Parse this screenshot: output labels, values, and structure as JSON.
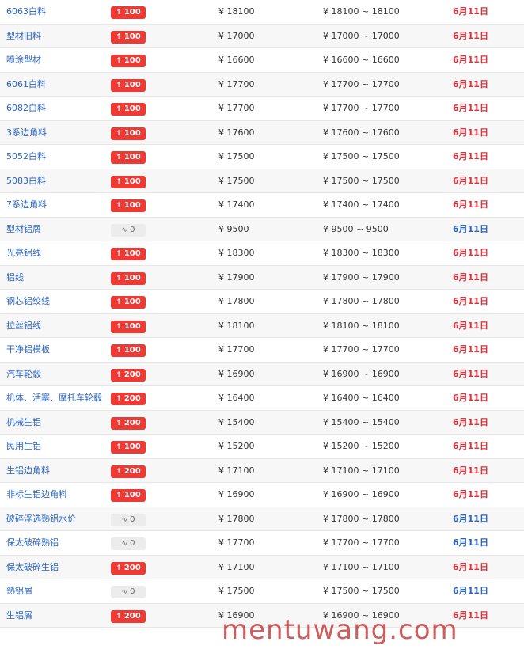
{
  "currency_symbol": "¥",
  "range_separator": "~",
  "rows": [
    {
      "name": "6063白料",
      "change": "100",
      "trend": "up",
      "price": "18100",
      "range_low": "18100",
      "range_high": "18100",
      "date": "6月11日"
    },
    {
      "name": "型材旧料",
      "change": "100",
      "trend": "up",
      "price": "17000",
      "range_low": "17000",
      "range_high": "17000",
      "date": "6月11日"
    },
    {
      "name": "喷涂型材",
      "change": "100",
      "trend": "up",
      "price": "16600",
      "range_low": "16600",
      "range_high": "16600",
      "date": "6月11日"
    },
    {
      "name": "6061白料",
      "change": "100",
      "trend": "up",
      "price": "17700",
      "range_low": "17700",
      "range_high": "17700",
      "date": "6月11日"
    },
    {
      "name": "6082白料",
      "change": "100",
      "trend": "up",
      "price": "17700",
      "range_low": "17700",
      "range_high": "17700",
      "date": "6月11日"
    },
    {
      "name": "3系边角料",
      "change": "100",
      "trend": "up",
      "price": "17600",
      "range_low": "17600",
      "range_high": "17600",
      "date": "6月11日"
    },
    {
      "name": "5052白料",
      "change": "100",
      "trend": "up",
      "price": "17500",
      "range_low": "17500",
      "range_high": "17500",
      "date": "6月11日"
    },
    {
      "name": "5083白料",
      "change": "100",
      "trend": "up",
      "price": "17500",
      "range_low": "17500",
      "range_high": "17500",
      "date": "6月11日"
    },
    {
      "name": "7系边角料",
      "change": "100",
      "trend": "up",
      "price": "17400",
      "range_low": "17400",
      "range_high": "17400",
      "date": "6月11日"
    },
    {
      "name": "型材铝屑",
      "change": "0",
      "trend": "flat",
      "price": "9500",
      "range_low": "9500",
      "range_high": "9500",
      "date": "6月11日"
    },
    {
      "name": "光亮铝线",
      "change": "100",
      "trend": "up",
      "price": "18300",
      "range_low": "18300",
      "range_high": "18300",
      "date": "6月11日"
    },
    {
      "name": "铝线",
      "change": "100",
      "trend": "up",
      "price": "17900",
      "range_low": "17900",
      "range_high": "17900",
      "date": "6月11日"
    },
    {
      "name": "钢芯铝绞线",
      "change": "100",
      "trend": "up",
      "price": "17800",
      "range_low": "17800",
      "range_high": "17800",
      "date": "6月11日"
    },
    {
      "name": "拉丝铝线",
      "change": "100",
      "trend": "up",
      "price": "18100",
      "range_low": "18100",
      "range_high": "18100",
      "date": "6月11日"
    },
    {
      "name": "干净铝模板",
      "change": "100",
      "trend": "up",
      "price": "17700",
      "range_low": "17700",
      "range_high": "17700",
      "date": "6月11日"
    },
    {
      "name": "汽车轮毂",
      "change": "200",
      "trend": "up",
      "price": "16900",
      "range_low": "16900",
      "range_high": "16900",
      "date": "6月11日"
    },
    {
      "name": "机体、活塞、摩托车轮毂",
      "change": "200",
      "trend": "up",
      "price": "16400",
      "range_low": "16400",
      "range_high": "16400",
      "date": "6月11日"
    },
    {
      "name": "机械生铝",
      "change": "200",
      "trend": "up",
      "price": "15400",
      "range_low": "15400",
      "range_high": "15400",
      "date": "6月11日"
    },
    {
      "name": "民用生铝",
      "change": "100",
      "trend": "up",
      "price": "15200",
      "range_low": "15200",
      "range_high": "15200",
      "date": "6月11日"
    },
    {
      "name": "生铝边角料",
      "change": "200",
      "trend": "up",
      "price": "17100",
      "range_low": "17100",
      "range_high": "17100",
      "date": "6月11日"
    },
    {
      "name": "非标生铝边角料",
      "change": "100",
      "trend": "up",
      "price": "16900",
      "range_low": "16900",
      "range_high": "16900",
      "date": "6月11日"
    },
    {
      "name": "破碎浮选熟铝水价",
      "change": "0",
      "trend": "flat",
      "price": "17800",
      "range_low": "17800",
      "range_high": "17800",
      "date": "6月11日"
    },
    {
      "name": "保太破碎熟铝",
      "change": "0",
      "trend": "flat",
      "price": "17700",
      "range_low": "17700",
      "range_high": "17700",
      "date": "6月11日"
    },
    {
      "name": "保太破碎生铝",
      "change": "200",
      "trend": "up",
      "price": "17100",
      "range_low": "17100",
      "range_high": "17100",
      "date": "6月11日"
    },
    {
      "name": "熟铝屑",
      "change": "0",
      "trend": "flat",
      "price": "17500",
      "range_low": "17500",
      "range_high": "17500",
      "date": "6月11日"
    },
    {
      "name": "生铝屑",
      "change": "200",
      "trend": "up",
      "price": "16900",
      "range_low": "16900",
      "range_high": "16900",
      "date": "6月11日"
    }
  ],
  "trend_icons": {
    "up": "arrow-up-icon",
    "flat": "wave-icon"
  },
  "colors": {
    "up": "#ee3a34",
    "flat_badge": "#ececec",
    "link": "#2a64c2",
    "date_up": "#e0303a",
    "date_flat": "#2a64c2"
  },
  "watermark": "mentuwang.com"
}
